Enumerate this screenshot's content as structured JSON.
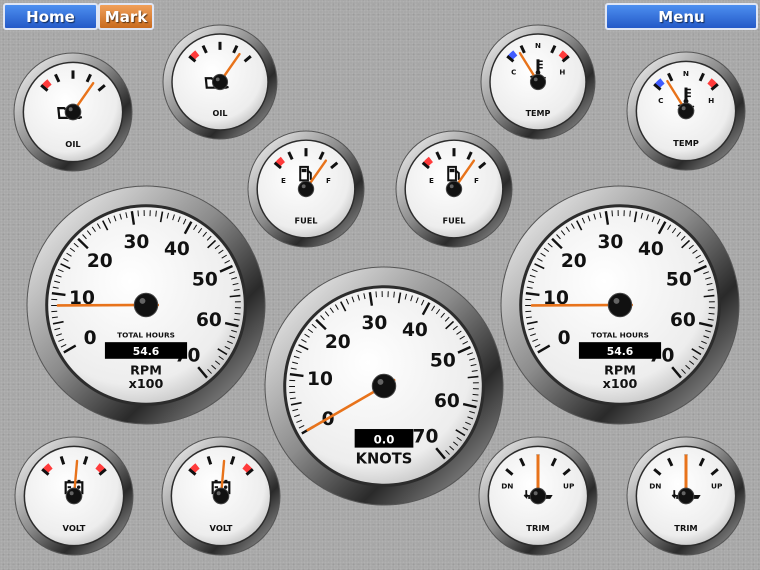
{
  "nav": {
    "home": "Home",
    "mark": "Mark",
    "menu": "Menu"
  },
  "colors": {
    "needle": "#e8731b",
    "redzone": "#ff3b3b",
    "bluezone": "#3f5bff",
    "nav_blue": "#2f6fe0",
    "nav_orange": "#dc8030"
  },
  "icons": {
    "oil": "oil-can-icon",
    "fuel": "fuel-pump-icon",
    "temp": "coolant-temp-icon",
    "volt": "battery-icon",
    "trim": "trim-icon"
  },
  "gauges": {
    "oil1": {
      "label": "OIL",
      "value": 0.85
    },
    "oil2": {
      "label": "OIL",
      "value": 0.85
    },
    "temp1": {
      "label": "TEMP",
      "cold": "C",
      "mid": "N",
      "hot": "H",
      "value": 0.18
    },
    "temp2": {
      "label": "TEMP",
      "cold": "C",
      "mid": "N",
      "hot": "H",
      "value": 0.18
    },
    "fuel1": {
      "label": "FUEL",
      "empty": "E",
      "full": "F",
      "value": 0.85
    },
    "fuel2": {
      "label": "FUEL",
      "empty": "E",
      "full": "F",
      "value": 0.85
    },
    "rpm1": {
      "ticks": [
        "0",
        "10",
        "20",
        "30",
        "40",
        "50",
        "60",
        "70"
      ],
      "label": "RPM",
      "sublabel": "x100",
      "hours_label": "TOTAL HOURS",
      "hours": "54.6",
      "value": 8
    },
    "rpm2": {
      "ticks": [
        "0",
        "10",
        "20",
        "30",
        "40",
        "50",
        "60",
        "70"
      ],
      "label": "RPM",
      "sublabel": "x100",
      "hours_label": "TOTAL HOURS",
      "hours": "54.6",
      "value": 8
    },
    "knots": {
      "ticks": [
        "0",
        "10",
        "20",
        "30",
        "40",
        "50",
        "60",
        "70"
      ],
      "label": "KNOTS",
      "readout": "0.0",
      "value": 0
    },
    "volt1": {
      "label": "VOLT",
      "value": 0.55
    },
    "volt2": {
      "label": "VOLT",
      "value": 0.55
    },
    "trim1": {
      "label": "TRIM",
      "down": "DN",
      "up": "UP",
      "value": 0.5
    },
    "trim2": {
      "label": "TRIM",
      "down": "DN",
      "up": "UP",
      "value": 0.5
    }
  }
}
